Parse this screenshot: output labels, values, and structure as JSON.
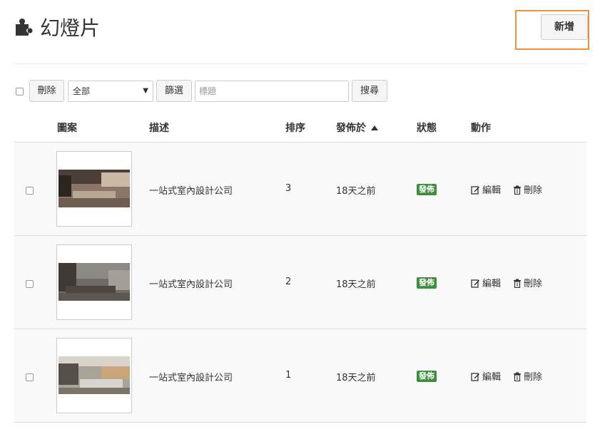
{
  "header": {
    "title": "幻燈片",
    "add_label": "新增"
  },
  "toolbar": {
    "delete_label": "刪除",
    "filter_select_value": "全部",
    "filter_label": "篩選",
    "search_placeholder": "標題",
    "search_label": "搜尋"
  },
  "table": {
    "columns": {
      "image": "圖案",
      "description": "描述",
      "order": "排序",
      "published": "發佈於",
      "status": "狀態",
      "actions": "動作"
    },
    "rows": [
      {
        "description": "一站式室內設計公司",
        "order": "3",
        "published": "18天之前",
        "status": "發佈",
        "edit": "編輯",
        "delete": "刪除"
      },
      {
        "description": "一站式室內設計公司",
        "order": "2",
        "published": "18天之前",
        "status": "發佈",
        "edit": "編輯",
        "delete": "刪除"
      },
      {
        "description": "一站式室內設計公司",
        "order": "1",
        "published": "18天之前",
        "status": "發佈",
        "edit": "編輯",
        "delete": "刪除"
      }
    ]
  },
  "colors": {
    "highlight_border": "#f0913a",
    "status_badge": "#3e8d3e"
  },
  "icons": {
    "title": "puzzle-icon",
    "edit": "edit-icon",
    "delete": "trash-icon",
    "sort": "sort-asc-icon"
  }
}
